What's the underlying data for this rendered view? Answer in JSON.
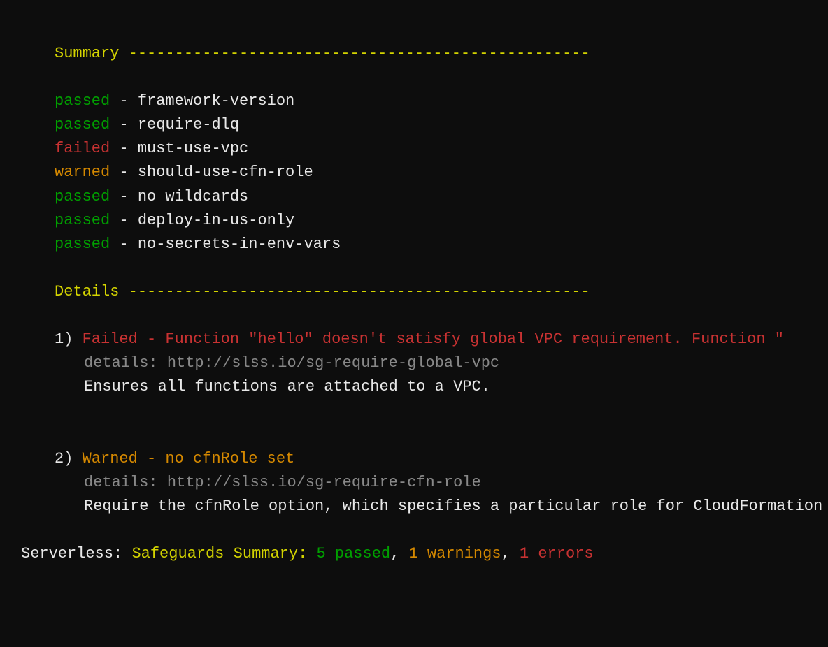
{
  "summary": {
    "header": "Summary --------------------------------------------------",
    "checks": [
      {
        "status": "passed",
        "statusClass": "green",
        "name": "framework-version"
      },
      {
        "status": "passed",
        "statusClass": "green",
        "name": "require-dlq"
      },
      {
        "status": "failed",
        "statusClass": "red",
        "name": "must-use-vpc"
      },
      {
        "status": "warned",
        "statusClass": "orange",
        "name": "should-use-cfn-role"
      },
      {
        "status": "passed",
        "statusClass": "green",
        "name": "no wildcards"
      },
      {
        "status": "passed",
        "statusClass": "green",
        "name": "deploy-in-us-only"
      },
      {
        "status": "passed",
        "statusClass": "green",
        "name": "no-secrets-in-env-vars"
      }
    ]
  },
  "details": {
    "header": "Details --------------------------------------------------",
    "items": [
      {
        "index": "1)",
        "status": "Failed",
        "statusClass": "red",
        "message": "Function \"hello\" doesn't satisfy global VPC requirement. Function \"",
        "detailsLabel": "details:",
        "detailsUrl": "http://slss.io/sg-require-global-vpc",
        "description": "Ensures all functions are attached to a VPC."
      },
      {
        "index": "2)",
        "status": "Warned",
        "statusClass": "orange",
        "message": "no cfnRole set",
        "detailsLabel": "details:",
        "detailsUrl": "http://slss.io/sg-require-cfn-role",
        "description": "Require the cfnRole option, which specifies a particular role for CloudFormation"
      }
    ]
  },
  "footer": {
    "prefix": "Serverless:",
    "summaryLabel": "Safeguards Summary:",
    "passedCount": "5 passed",
    "sep1": ",",
    "warningsCount": "1 warnings",
    "sep2": ",",
    "errorsCount": "1 errors"
  }
}
